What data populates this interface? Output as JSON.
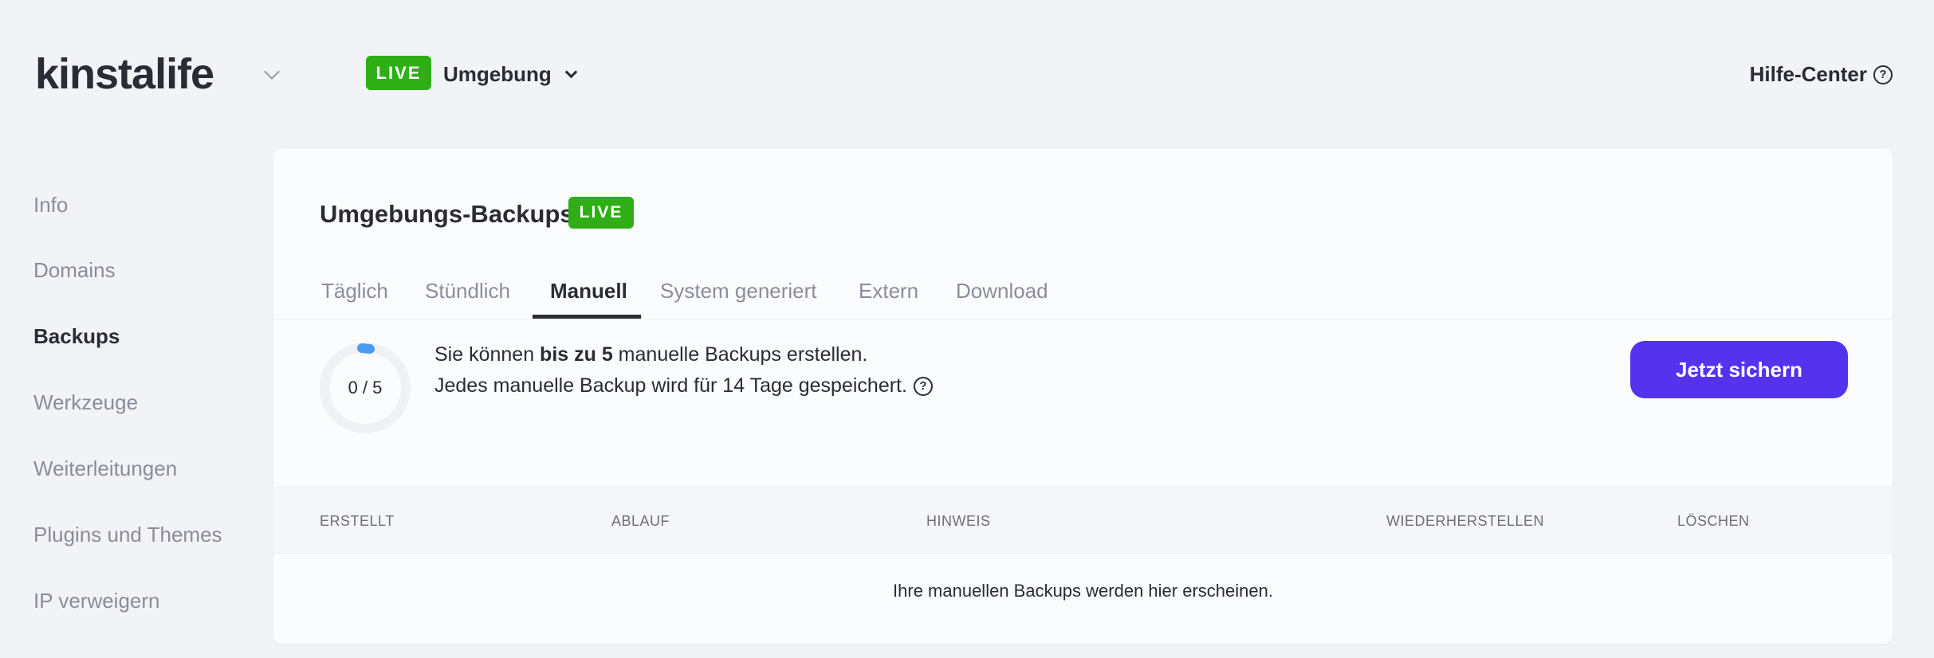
{
  "header": {
    "logo": "kinstalife",
    "env_badge": "LIVE",
    "env_label": "Umgebung",
    "help": "Hilfe-Center"
  },
  "sidebar": {
    "items": [
      {
        "label": "Info"
      },
      {
        "label": "Domains"
      },
      {
        "label": "Backups",
        "active": true
      },
      {
        "label": "Werkzeuge"
      },
      {
        "label": "Weiterleitungen"
      },
      {
        "label": "Plugins und Themes"
      },
      {
        "label": "IP verweigern"
      }
    ]
  },
  "card": {
    "title": "Umgebungs-Backups",
    "badge": "LIVE",
    "tabs": [
      {
        "label": "Täglich"
      },
      {
        "label": "Stündlich"
      },
      {
        "label": "Manuell",
        "active": true
      },
      {
        "label": "System generiert"
      },
      {
        "label": "Extern"
      },
      {
        "label": "Download"
      }
    ],
    "usage": {
      "label": "0 / 5",
      "used": 0,
      "max": 5
    },
    "line1_pre": "Sie können ",
    "line1_bold": "bis zu 5",
    "line1_post": " manuelle Backups erstellen.",
    "line2": "Jedes manuelle Backup wird für 14 Tage gespeichert.",
    "button": "Jetzt sichern",
    "table": {
      "headers": [
        "ERSTELLT",
        "ABLAUF",
        "HINWEIS",
        "WIEDERHERSTELLEN",
        "LÖSCHEN"
      ],
      "empty": "Ihre manuellen Backups werden hier erscheinen."
    }
  },
  "colors": {
    "live": "#2fae16",
    "accent": "#5333ed",
    "ring": "#4c9bf5"
  }
}
